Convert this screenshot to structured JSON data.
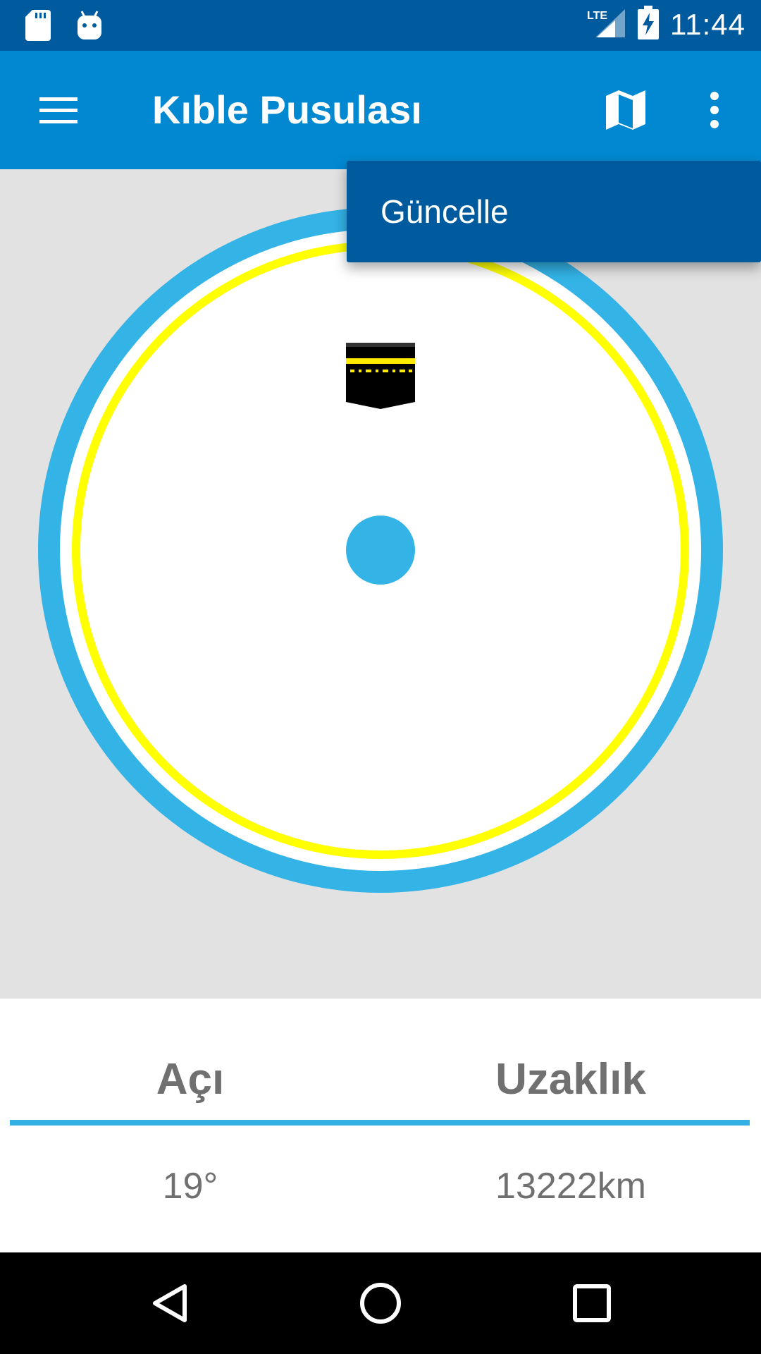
{
  "status_bar": {
    "time": "11:44",
    "network": "LTE",
    "icons": [
      "sd-card-icon",
      "android-debug-icon",
      "signal-icon",
      "battery-charging-icon"
    ]
  },
  "app_bar": {
    "title": "Kıble Pusulası",
    "icons": [
      "menu-icon",
      "map-icon",
      "more-vert-icon"
    ]
  },
  "menu": {
    "items": [
      {
        "label": "Güncelle"
      }
    ]
  },
  "compass": {
    "icons": [
      "kaaba-icon",
      "compass-center-dot"
    ],
    "colors": {
      "outer_ring": "#33b3e6",
      "inner_ring": "#ffff00",
      "dot": "#33b3e6",
      "background": "#e2e2e2"
    }
  },
  "info": {
    "angle": {
      "label": "Açı",
      "value": "19°"
    },
    "distance": {
      "label": "Uzaklık",
      "value": "13222km"
    }
  },
  "nav_bar": {
    "icons": [
      "back-icon",
      "home-icon",
      "recents-icon"
    ]
  },
  "colors": {
    "status_bar": "#005a9e",
    "app_bar": "#0288d1",
    "accent": "#33b0e6",
    "text_gray": "#707070"
  }
}
